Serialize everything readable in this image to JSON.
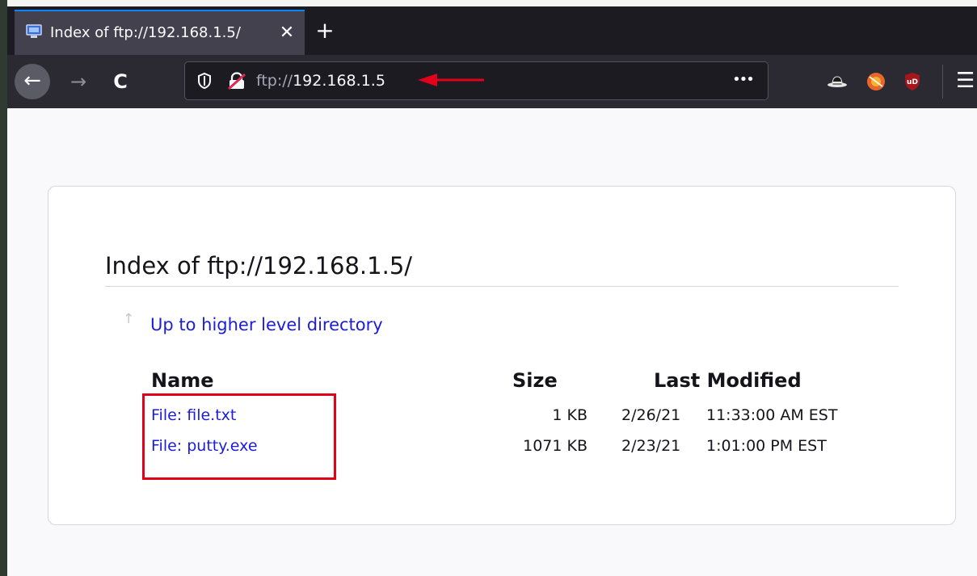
{
  "tab": {
    "title": "Index of ftp://192.168.1.5/",
    "close_glyph": "✕",
    "favicon": "monitor-icon"
  },
  "tabbar": {
    "new_tab_glyph": "+"
  },
  "toolbar": {
    "back_glyph": "←",
    "forward_glyph": "→",
    "reload_glyph": "C",
    "url_scheme": "ftp://",
    "url_host": "192.168.1.5",
    "more_glyph": "•••",
    "menu_glyph": "☰",
    "extensions": [
      "hat-icon",
      "ball-icon",
      "ublock-origin-icon"
    ]
  },
  "page": {
    "heading": "Index of ftp://192.168.1.5/",
    "up_link": "Up to higher level directory",
    "up_glyph": "↑",
    "columns": {
      "name": "Name",
      "size": "Size",
      "modified": "Last Modified"
    },
    "files": [
      {
        "name": "File: file.txt",
        "size": "1 KB",
        "date": "2/26/21",
        "time": "11:33:00 AM EST"
      },
      {
        "name": "File: putty.exe",
        "size": "1071 KB",
        "date": "2/23/21",
        "time": "1:01:00 PM EST"
      }
    ]
  },
  "colors": {
    "link": "#1c1cdd",
    "annotation": "#e2001a",
    "tab_accent": "#0a84ff",
    "toolbar_bg": "#2b2a33",
    "tabstrip_bg": "#1c1b22"
  }
}
